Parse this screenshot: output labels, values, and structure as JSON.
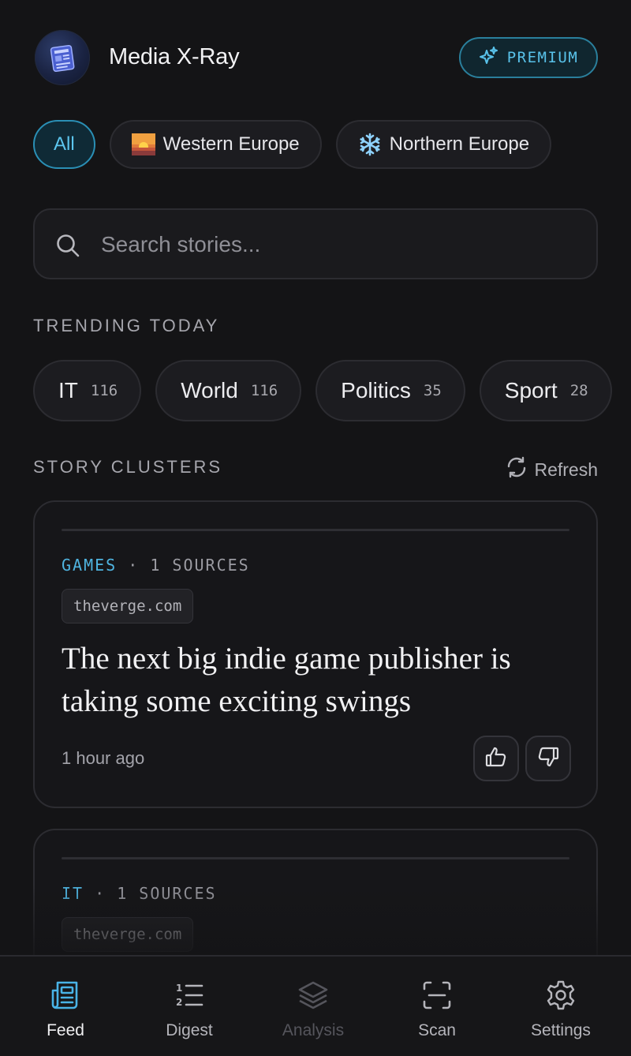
{
  "header": {
    "title": "Media X-Ray",
    "premium_label": "PREMIUM",
    "logo_icon": "newspaper-icon"
  },
  "regions": [
    {
      "label": "All",
      "active": true
    },
    {
      "label": "Western Europe",
      "icon": "sunrise-flag-icon"
    },
    {
      "label": "Northern Europe",
      "icon": "snowflake-icon"
    }
  ],
  "search": {
    "placeholder": "Search stories..."
  },
  "trending": {
    "title": "TRENDING TODAY",
    "topics": [
      {
        "name": "IT",
        "count": "116"
      },
      {
        "name": "World",
        "count": "116"
      },
      {
        "name": "Politics",
        "count": "35"
      },
      {
        "name": "Sport",
        "count": "28"
      }
    ]
  },
  "clusters": {
    "title": "STORY CLUSTERS",
    "refresh_label": "Refresh",
    "cards": [
      {
        "category": "GAMES",
        "separator": " · ",
        "sources": "1 SOURCES",
        "source_domain": "theverge.com",
        "headline": "The next big indie game publisher is taking some exciting swings",
        "time": "1 hour ago"
      },
      {
        "category": "IT",
        "separator": " · ",
        "sources": "1 SOURCES",
        "source_domain": "theverge.com"
      }
    ]
  },
  "nav": [
    {
      "label": "Feed",
      "icon": "feed-icon",
      "state": "active"
    },
    {
      "label": "Digest",
      "icon": "numbered-list-icon",
      "state": "normal"
    },
    {
      "label": "Analysis",
      "icon": "layers-icon",
      "state": "disabled"
    },
    {
      "label": "Scan",
      "icon": "scan-icon",
      "state": "normal"
    },
    {
      "label": "Settings",
      "icon": "gear-icon",
      "state": "normal"
    }
  ],
  "colors": {
    "background": "#141416",
    "accent": "#4fb4e0",
    "card_border": "#2c2c31"
  }
}
